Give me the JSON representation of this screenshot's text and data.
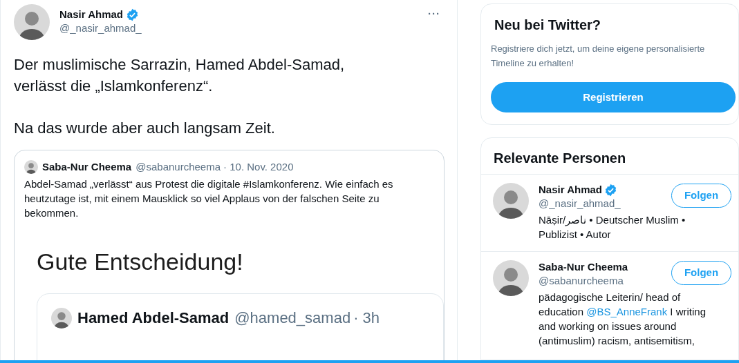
{
  "tweet": {
    "author": {
      "name": "Nasir Ahmad",
      "handle": "@_nasir_ahmad_",
      "verified": true
    },
    "more": "···",
    "paragraphs": [
      "Der muslimische Sarrazin, Hamed Abdel-Samad, verlässt die „Islamkonferenz“.",
      "Na das wurde aber auch langsam Zeit."
    ],
    "quote": {
      "name": "Saba-Nur Cheema",
      "handle": "@sabanurcheema",
      "date": "· 10. Nov. 2020",
      "text": "Abdel-Samad „verlässt“ aus Protest die digitale #Islamkonferenz. Wie einfach es heutzutage ist, mit einem Mausklick so viel Applaus von der falschen Seite zu bekommen.",
      "image": {
        "heading": "Gute Entscheidung!",
        "inner": {
          "name": "Hamed Abdel-Samad",
          "handle": "@hamed_samad",
          "time": "· 3h"
        }
      }
    }
  },
  "signup": {
    "title": "Neu bei Twitter?",
    "text": "Registriere dich jetzt, um deine eigene personalisierte Timeline zu erhalten!",
    "button": "Registrieren"
  },
  "people": {
    "title": "Relevante Personen",
    "items": [
      {
        "name": "Nasir Ahmad",
        "handle": "@_nasir_ahmad_",
        "verified": true,
        "follow": "Folgen",
        "bio": [
          {
            "kind": "text",
            "text": "Nāṣir/ناصر • Deutscher Muslim • Publizist • Autor"
          }
        ]
      },
      {
        "name": "Saba-Nur Cheema",
        "handle": "@sabanurcheema",
        "verified": false,
        "follow": "Folgen",
        "bio": [
          {
            "kind": "text",
            "text": "pädagogische Leiterin/ head of education "
          },
          {
            "kind": "link",
            "text": "@BS_AnneFrank"
          },
          {
            "kind": "text",
            "text": " I writing and working on issues around (antimuslim) racism, antisemitism,"
          }
        ]
      }
    ]
  }
}
